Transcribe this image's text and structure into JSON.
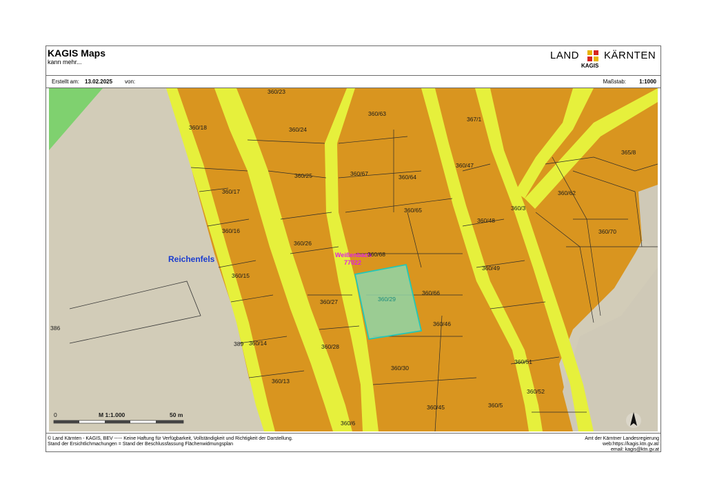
{
  "header": {
    "title": "KAGIS Maps",
    "subtitle": "kann mehr...",
    "logo_left": "LAND",
    "logo_right": "KÄRNTEN",
    "logo_sub": "KAGIS"
  },
  "info": {
    "created_label": "Erstellt am:",
    "created_value": "13.02.2025",
    "by_label": "von:",
    "scale_label": "Maßstab:",
    "scale_value": "1:1000"
  },
  "map": {
    "colors": {
      "parcel_fill": "#d9951f",
      "road": "#e6f03c",
      "selected": "#8fd6a8",
      "selected_border": "#22c7b8",
      "green_area": "#7fd16f",
      "place": "#1a3ccf",
      "stream": "#e020e0"
    },
    "place_name": "Reichenfels",
    "stream_name": "Weißenbach",
    "stream_id": "77022",
    "selected_parcel": "360/29",
    "parcel_labels": [
      "360/23",
      "360/63",
      "367/1",
      "360/18",
      "360/24",
      "365/8",
      "360/67",
      "360/64",
      "360/47",
      "360/25",
      "360/17",
      "360/62",
      "360/65",
      "360/3",
      "360/48",
      "360/16",
      "360/70",
      "360/26",
      "360/68",
      "360/49",
      "360/15",
      "360/66",
      "360/27",
      "386",
      "360/46",
      "389",
      "360/14",
      "360/28",
      "360/51",
      "360/30",
      "360/13",
      "360/52",
      "360/45",
      "360/5",
      "360/6"
    ],
    "scalebar": {
      "left": "0",
      "mid": "M 1:1.000",
      "right": "50 m"
    },
    "north_arrow_icon": "north-arrow-icon"
  },
  "footer": {
    "left_line1": "© Land Kärnten - KAGIS, BEV ----- Keine Haftung für Verfügbarkeit, Vollständigkeit und Richtigkeit der Darstellung.",
    "left_line2": "Stand der Ersichtlichmachungen = Stand der Beschlussfassung Flächenwidmungsplan",
    "right_line1": "Amt der Kärntner Landesregierung",
    "right_line2": "web:https://kagis.ktn.gv.at/",
    "right_line3": "email: kagis@ktn.gv.at"
  }
}
